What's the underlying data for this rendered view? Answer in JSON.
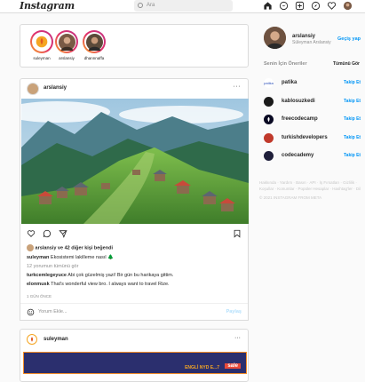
{
  "header": {
    "logo": "Instagram",
    "search_placeholder": "Ara"
  },
  "nav_icons": [
    "home-icon",
    "messenger-icon",
    "new-post-icon",
    "explore-icon",
    "heart-icon",
    "profile-avatar"
  ],
  "stories": [
    {
      "name": "suleyman",
      "color": "#f5a623"
    },
    {
      "name": "arslansiy",
      "color": "#7a5a45"
    },
    {
      "name": "dhannnaffa",
      "color": "#5b4a3a"
    }
  ],
  "post": {
    "username": "arslansiy",
    "more": "···",
    "liked_by_user": "arslansiy",
    "liked_by_text": "ve 42 diğer kişi beğendi",
    "caption_user": "suleyman",
    "caption_text": "Ekosistemi lakilleme nasıl 🌲",
    "view_comments": "12 yorumun tümünü gör",
    "comments": [
      {
        "user": "turkcemlegeyuce",
        "text": "Abi çok güzelmiş yazi! Bir gün bu harikaya gittim."
      },
      {
        "user": "elonmusk",
        "text": "That's wonderful view bro. I always want to travel Rize."
      }
    ],
    "time": "1 GÜN ÖNCE",
    "comment_placeholder": "Yorum Ekle...",
    "post_button": "Paylaş"
  },
  "sidebar": {
    "username": "arslansiy",
    "subtitle": "Süleyman Arslansiy",
    "switch": "Geçiş yap",
    "suggest_header": "Senin İçin Öneriler",
    "suggest_all": "Tümünü Gör",
    "suggestions": [
      {
        "name": "patika",
        "follow": "Takip Et",
        "color": "#ffffff",
        "icon": "patika-logo"
      },
      {
        "name": "kablosuzkedi",
        "follow": "Takip Et",
        "color": "#1a1a1a",
        "icon": "kablosuzkedi-logo"
      },
      {
        "name": "freecodecamp",
        "follow": "Takip Et",
        "color": "#0a0a23",
        "icon": "freecodecamp-logo"
      },
      {
        "name": "turkishdevelopers",
        "follow": "Takip Et",
        "color": "#c0392b",
        "icon": "turkishdevelopers-logo"
      },
      {
        "name": "codecademy",
        "follow": "Takip Et",
        "color": "#1f1f3a",
        "icon": "codecademy-logo"
      }
    ],
    "footer_line1": "Hakkında · Yardım · Basın · API · İş Fırsatları · Gizlilik · Koşullar · Konumlar · Popüler Hesaplar · Hashtag'ler · Dil",
    "footer_line2": "© 2021 INSTAGRAM FROM META"
  },
  "post2": {
    "username": "suleyman",
    "more": "···",
    "banner_text": "ENGLİ NYD E...7",
    "banner_tag": "sale"
  }
}
